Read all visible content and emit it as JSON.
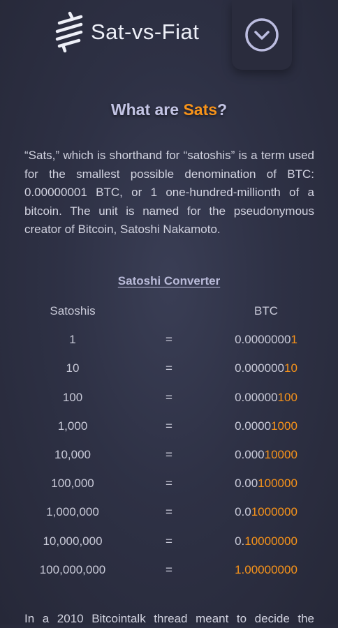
{
  "header": {
    "logo_text": "Sat-vs-Fiat",
    "menu_icon": "chevron-down-circle-icon"
  },
  "heading": {
    "part1": "What are ",
    "accent": "Sats",
    "part2": "?"
  },
  "intro": "“Sats,” which is shorthand for “satoshis” is a term used for the smallest possible denomination of BTC: 0.00000001 BTC, or 1 one-hundred-millionth of a bitcoin. The unit is named for the pseudonymous creator of Bitcoin, Satoshi Nakamoto.",
  "converter": {
    "title": "Satoshi Converter",
    "col_sats": "Satoshis",
    "col_btc": "BTC",
    "equals": "=",
    "rows": [
      {
        "sats": "1",
        "btc_prefix": "0.0000000",
        "btc_highlight": "1"
      },
      {
        "sats": "10",
        "btc_prefix": "0.000000",
        "btc_highlight": "10"
      },
      {
        "sats": "100",
        "btc_prefix": "0.00000",
        "btc_highlight": "100"
      },
      {
        "sats": "1,000",
        "btc_prefix": "0.0000",
        "btc_highlight": "1000"
      },
      {
        "sats": "10,000",
        "btc_prefix": "0.000",
        "btc_highlight": "10000"
      },
      {
        "sats": "100,000",
        "btc_prefix": "0.00",
        "btc_highlight": "100000"
      },
      {
        "sats": "1,000,000",
        "btc_prefix": "0.0",
        "btc_highlight": "1000000"
      },
      {
        "sats": "10,000,000",
        "btc_prefix": "0.",
        "btc_highlight": "10000000"
      },
      {
        "sats": "100,000,000",
        "btc_prefix": "",
        "btc_highlight": "1.00000000"
      }
    ]
  },
  "footer_text": "In a 2010 Bitcointalk thread meant to decide the",
  "colors": {
    "accent": "#f7931a",
    "background": "#2e3145",
    "heading": "#c3c4e4"
  }
}
